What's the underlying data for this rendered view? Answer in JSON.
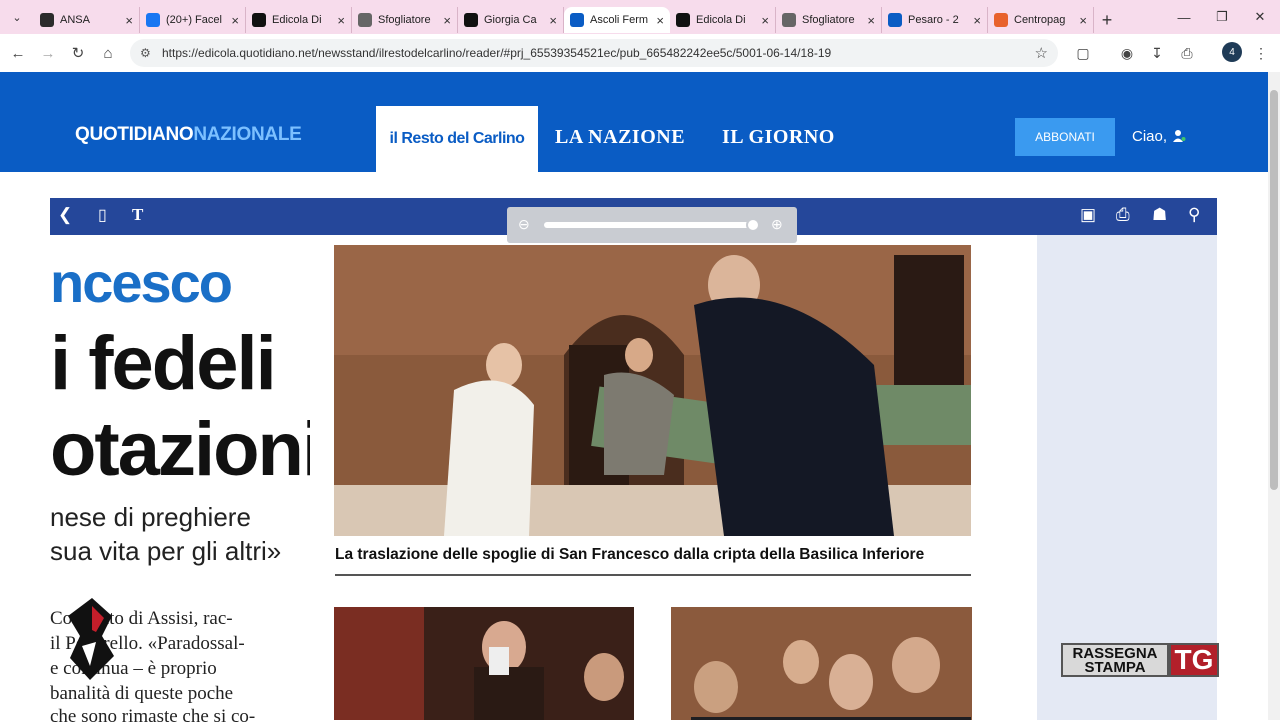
{
  "browser": {
    "tabs": [
      {
        "title": "ANSA",
        "favicon": "ansa-icon",
        "color": "#2b2b2b",
        "active": false
      },
      {
        "title": "(20+) Facel",
        "favicon": "facebook-icon",
        "color": "#1877f2",
        "active": false
      },
      {
        "title": "Edicola Di",
        "favicon": "edicola-icon",
        "color": "#111111",
        "active": false
      },
      {
        "title": "Sfogliatore",
        "favicon": "globe-icon",
        "color": "#666666",
        "active": false
      },
      {
        "title": "Giorgia Ca",
        "favicon": "medium-icon",
        "color": "#111111",
        "active": false
      },
      {
        "title": "Ascoli Ferm",
        "favicon": "qn-icon",
        "color": "#0a5cc4",
        "active": true
      },
      {
        "title": "Edicola Di",
        "favicon": "edicola-icon",
        "color": "#111111",
        "active": false
      },
      {
        "title": "Sfogliatore",
        "favicon": "globe-icon",
        "color": "#666666",
        "active": false
      },
      {
        "title": "Pesaro - 2",
        "favicon": "qn-icon",
        "color": "#0a5cc4",
        "active": false
      },
      {
        "title": "Centropag",
        "favicon": "centropagina-icon",
        "color": "#e8622c",
        "active": false
      }
    ],
    "url": "https://edicola.quotidiano.net/newsstand/ilrestodelcarlino/reader/#prj_65539354521ec/pub_665482242ee5c/5001-06-14/18-19",
    "profile_initial": "4"
  },
  "site": {
    "brand_a": "QUOTIDIANO",
    "brand_b": "NAZIONALE",
    "tabs": [
      "il Resto del Carlino",
      "LA NAZIONE",
      "IL GIORNO"
    ],
    "subscribe_label": "ABBONATI",
    "greeting": "Ciao,"
  },
  "article": {
    "headline_lines": [
      "ncesco",
      "i fedeli",
      "otazioni"
    ],
    "sub_lines": [
      "nese di preghiere",
      "sua vita per gli altri»"
    ],
    "body_lines": [
      "Convento di Assisi, rac-",
      "il Poverello. «Paradossal-",
      "e continua – è proprio",
      "banalità di queste poche",
      "che sono rimaste che si co-"
    ],
    "caption": "La traslazione delle spoglie di San Francesco dalla cripta della Basilica Inferiore"
  },
  "overlay": {
    "rassegna_line1": "RASSEGNA",
    "rassegna_line2": "STAMPA",
    "tg": "TG"
  }
}
